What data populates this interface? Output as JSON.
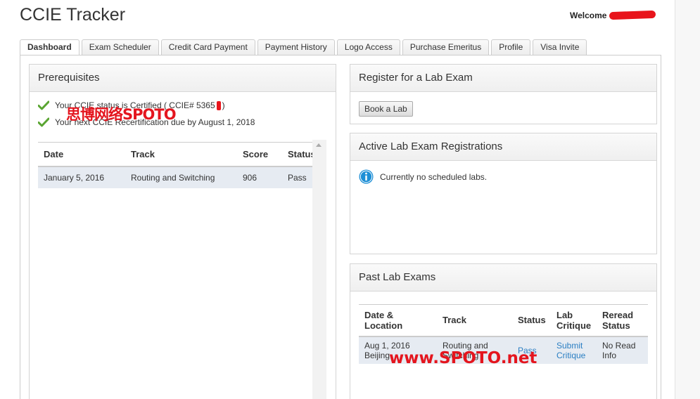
{
  "app": {
    "title": "CCIE Tracker",
    "welcome_label": "Welcome"
  },
  "tabs": [
    {
      "label": "Dashboard",
      "active": true
    },
    {
      "label": "Exam Scheduler"
    },
    {
      "label": "Credit Card Payment"
    },
    {
      "label": "Payment History"
    },
    {
      "label": "Logo Access"
    },
    {
      "label": "Purchase Emeritus"
    },
    {
      "label": "Profile"
    },
    {
      "label": "Visa Invite"
    }
  ],
  "prerequisites": {
    "title": "Prerequisites",
    "status_lines": [
      "Your CCIE status is Certified ( CCIE# 5365",
      "Your next CCIE Recertification due by August 1, 2018"
    ],
    "status_suffix": ")",
    "table": {
      "headers": [
        "Date",
        "Track",
        "Score",
        "Status"
      ],
      "rows": [
        {
          "date": "January 5, 2016",
          "track": "Routing and Switching",
          "score": "906",
          "status": "Pass"
        }
      ]
    }
  },
  "register": {
    "title": "Register for a Lab Exam",
    "button_label": "Book a Lab"
  },
  "active_registrations": {
    "title": "Active Lab Exam Registrations",
    "message": "Currently no scheduled labs."
  },
  "past_labs": {
    "title": "Past Lab Exams",
    "headers": {
      "date_line1": "Date &",
      "date_line2": "Location",
      "track": "Track",
      "status": "Status",
      "critique_line1": "Lab",
      "critique_line2": "Critique",
      "reread_line1": "Reread",
      "reread_line2": "Status"
    },
    "rows": [
      {
        "date": "Aug 1, 2016",
        "location": "Beijing",
        "track_line1": "Routing and",
        "track_line2": "Switching",
        "status": "Pass",
        "critique_line1": "Submit",
        "critique_line2": "Critique",
        "reread_line1": "No Read",
        "reread_line2": "Info"
      }
    ]
  },
  "watermarks": {
    "top": "思博网络SPOTO",
    "bottom": "www.SPOTO.net"
  },
  "colors": {
    "accent_link": "#2b7fc3",
    "check_green": "#5aa532",
    "info_blue": "#1e8fd6",
    "watermark_red": "#e4151e"
  },
  "icons": {
    "check": "check-icon",
    "info": "info-icon"
  }
}
